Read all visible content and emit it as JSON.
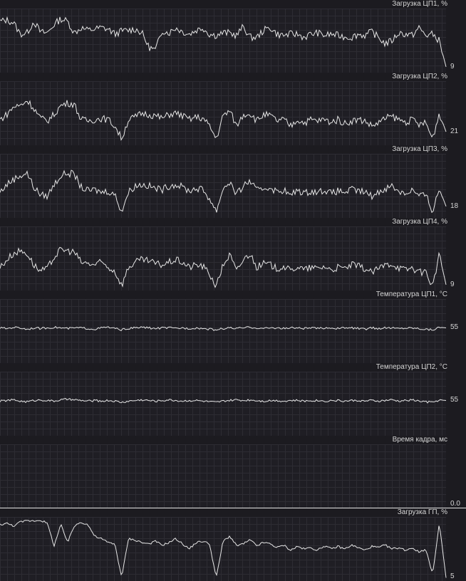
{
  "colors": {
    "background": "#1c1b20",
    "grid": "#2d2c33",
    "line": "#e6e6e6",
    "text": "#d6d6d6"
  },
  "panels": [
    {
      "title": "Загрузка ЦП1, %",
      "current_value": "9",
      "chart_data": {
        "type": "line",
        "ylim": [
          0,
          100
        ],
        "values": [
          80,
          82,
          78,
          60,
          62,
          80,
          63,
          62,
          75,
          84,
          80,
          62,
          70,
          66,
          68,
          70,
          68,
          60,
          65,
          66,
          68,
          62,
          40,
          35,
          66,
          62,
          70,
          64,
          60,
          66,
          70,
          60,
          58,
          62,
          62,
          58,
          72,
          55,
          55,
          66,
          70,
          60,
          58,
          60,
          60,
          55,
          60,
          62,
          58,
          60,
          58,
          56,
          55,
          60,
          58,
          64,
          55,
          45,
          50,
          62,
          60,
          58,
          70,
          58,
          60,
          50,
          9
        ]
      }
    },
    {
      "title": "Загрузка ЦП2, %",
      "current_value": "21",
      "chart_data": {
        "type": "line",
        "ylim": [
          0,
          100
        ],
        "values": [
          40,
          48,
          60,
          62,
          70,
          58,
          42,
          38,
          48,
          62,
          66,
          64,
          40,
          38,
          40,
          42,
          40,
          30,
          10,
          40,
          44,
          50,
          48,
          46,
          42,
          48,
          50,
          46,
          40,
          44,
          42,
          30,
          10,
          46,
          54,
          30,
          48,
          50,
          38,
          48,
          46,
          38,
          40,
          30,
          40,
          35,
          40,
          38,
          40,
          36,
          40,
          34,
          38,
          40,
          38,
          30,
          35,
          42,
          45,
          40,
          36,
          40,
          32,
          35,
          10,
          50,
          21
        ]
      }
    },
    {
      "title": "Загрузка ЦП3, %",
      "current_value": "18",
      "chart_data": {
        "type": "line",
        "ylim": [
          0,
          100
        ],
        "values": [
          40,
          52,
          60,
          66,
          70,
          48,
          36,
          34,
          52,
          66,
          70,
          68,
          48,
          42,
          44,
          40,
          42,
          36,
          10,
          40,
          50,
          52,
          50,
          46,
          44,
          50,
          52,
          48,
          42,
          46,
          44,
          30,
          10,
          46,
          56,
          36,
          50,
          58,
          42,
          46,
          48,
          40,
          44,
          34,
          44,
          38,
          42,
          40,
          44,
          38,
          42,
          40,
          44,
          42,
          40,
          34,
          40,
          46,
          50,
          42,
          38,
          44,
          34,
          36,
          10,
          46,
          18
        ]
      }
    },
    {
      "title": "Загрузка ЦП4, %",
      "current_value": "9",
      "chart_data": {
        "type": "line",
        "ylim": [
          0,
          100
        ],
        "values": [
          36,
          48,
          58,
          62,
          58,
          40,
          30,
          34,
          52,
          64,
          62,
          60,
          44,
          42,
          40,
          44,
          36,
          30,
          8,
          36,
          44,
          48,
          46,
          42,
          40,
          44,
          48,
          44,
          36,
          40,
          38,
          26,
          6,
          40,
          56,
          30,
          48,
          58,
          36,
          42,
          40,
          34,
          38,
          30,
          38,
          32,
          36,
          34,
          38,
          32,
          36,
          34,
          40,
          38,
          34,
          28,
          34,
          40,
          42,
          36,
          32,
          36,
          28,
          30,
          6,
          56,
          9
        ]
      }
    },
    {
      "title": "Температура ЦП1, °C",
      "current_value": "55",
      "chart_data": {
        "type": "line",
        "ylim": [
          0,
          100
        ],
        "values": [
          55,
          54,
          56,
          55,
          53,
          55,
          54,
          55,
          56,
          55,
          54,
          55,
          55,
          54,
          53,
          55,
          56,
          54,
          52,
          54,
          55,
          56,
          55,
          54,
          55,
          55,
          54,
          55,
          54,
          55,
          54,
          53,
          52,
          54,
          55,
          54,
          55,
          56,
          55,
          54,
          55,
          55,
          54,
          55,
          55,
          54,
          55,
          54,
          55,
          55,
          54,
          55,
          55,
          54,
          53,
          55,
          54,
          55,
          55,
          54,
          55,
          55,
          54,
          53,
          52,
          56,
          55
        ]
      }
    },
    {
      "title": "Температура ЦП2, °C",
      "current_value": "55",
      "chart_data": {
        "type": "line",
        "ylim": [
          0,
          100
        ],
        "values": [
          54,
          55,
          56,
          54,
          53,
          55,
          56,
          55,
          54,
          56,
          57,
          56,
          55,
          54,
          55,
          54,
          55,
          54,
          52,
          54,
          55,
          56,
          55,
          54,
          55,
          56,
          55,
          54,
          55,
          55,
          54,
          53,
          52,
          54,
          55,
          56,
          55,
          56,
          55,
          54,
          55,
          55,
          54,
          55,
          55,
          54,
          55,
          55,
          54,
          55,
          55,
          54,
          55,
          55,
          54,
          55,
          54,
          55,
          56,
          54,
          55,
          56,
          54,
          53,
          52,
          56,
          55
        ]
      }
    },
    {
      "title": "Время кадра, мс",
      "current_value": "0.0",
      "chart_data": {
        "type": "line",
        "ylim": [
          0,
          100
        ],
        "values": [
          0,
          0,
          0,
          0,
          0,
          0,
          0,
          0,
          0,
          0,
          0,
          0,
          0,
          0,
          0,
          0,
          0,
          0,
          0,
          0,
          0,
          0,
          0,
          0,
          0,
          0,
          0,
          0,
          0,
          0,
          0,
          0,
          0,
          0,
          0,
          0,
          0,
          0,
          0,
          0,
          0,
          0,
          0,
          0,
          0,
          0,
          0,
          0,
          0,
          0,
          0,
          0,
          0,
          0,
          0,
          0,
          0,
          0,
          0,
          0,
          0,
          0,
          0,
          0,
          0,
          0,
          0
        ]
      }
    },
    {
      "title": "Загрузка ГП, %",
      "current_value": "5",
      "chart_data": {
        "type": "line",
        "ylim": [
          0,
          100
        ],
        "values": [
          88,
          90,
          86,
          92,
          94,
          94,
          95,
          90,
          55,
          88,
          60,
          86,
          92,
          88,
          70,
          66,
          60,
          58,
          5,
          66,
          64,
          60,
          58,
          62,
          56,
          60,
          66,
          58,
          50,
          60,
          62,
          58,
          5,
          62,
          70,
          55,
          58,
          64,
          55,
          60,
          58,
          52,
          56,
          48,
          54,
          50,
          52,
          48,
          55,
          50,
          54,
          50,
          56,
          52,
          48,
          54,
          52,
          56,
          50,
          52,
          48,
          52,
          45,
          50,
          10,
          90,
          5
        ]
      }
    }
  ]
}
